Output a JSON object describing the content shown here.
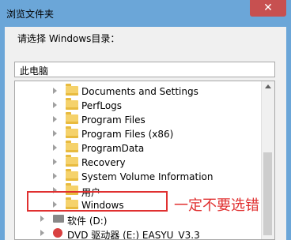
{
  "window": {
    "title": "浏览文件夹",
    "close_symbol": "✕"
  },
  "prompt": "请选择 Windows目录：",
  "path_value": "此电脑",
  "tree": {
    "folders": [
      "Documents and Settings",
      "PerfLogs",
      "Program Files",
      "Program Files (x86)",
      "ProgramData",
      "Recovery",
      "System Volume Information",
      "用户",
      "Windows"
    ],
    "drives": [
      "软件 (D:)",
      "DVD 驱动器 (E:) EASYU_V3.3"
    ]
  },
  "annotation": {
    "text": "一定不要选错",
    "color": "#e03030"
  }
}
